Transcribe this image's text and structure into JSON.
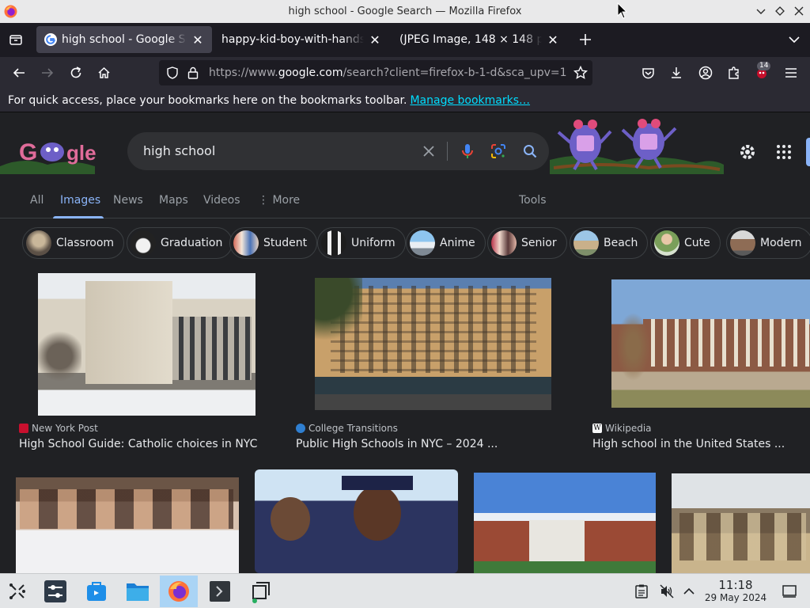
{
  "window": {
    "title": "high school - Google Search — Mozilla Firefox"
  },
  "tabs": [
    {
      "label": "high school - Google Search",
      "active": true
    },
    {
      "label": "happy-kid-boy-with-hands-thumbs-up",
      "active": false
    },
    {
      "label": "(JPEG Image, 148 × 148 pixels)",
      "active": false
    }
  ],
  "navbar": {
    "url_prefix": "https://www.",
    "url_host": "google.com",
    "url_rest": "/search?client=firefox-b-1-d&sca_upv=1",
    "extension_badge": "14"
  },
  "bookmarks_bar": {
    "message": "For quick access, place your bookmarks here on the bookmarks toolbar.",
    "link": "Manage bookmarks…"
  },
  "google": {
    "logo_text": "Google",
    "query": "high school",
    "nav_tabs": [
      "All",
      "Images",
      "News",
      "Maps",
      "Videos",
      "More",
      "Tools"
    ],
    "active_tab": "Images",
    "chips": [
      "Classroom",
      "Graduation",
      "Student",
      "Uniform",
      "Anime",
      "Senior",
      "Beach",
      "Cute",
      "Modern"
    ],
    "results": [
      {
        "source": "New York Post",
        "caption": "High School Guide: Catholic choices in NYC"
      },
      {
        "source": "College Transitions",
        "caption": "Public High Schools in NYC – 2024 ..."
      },
      {
        "source": "Wikipedia",
        "caption": "High school in the United States ..."
      }
    ]
  },
  "taskbar": {
    "time": "11:18",
    "date": "29 May 2024"
  },
  "colors": {
    "accent_blue": "#8ab4f8",
    "page_bg": "#202124",
    "link_cyan": "#00ddff"
  }
}
